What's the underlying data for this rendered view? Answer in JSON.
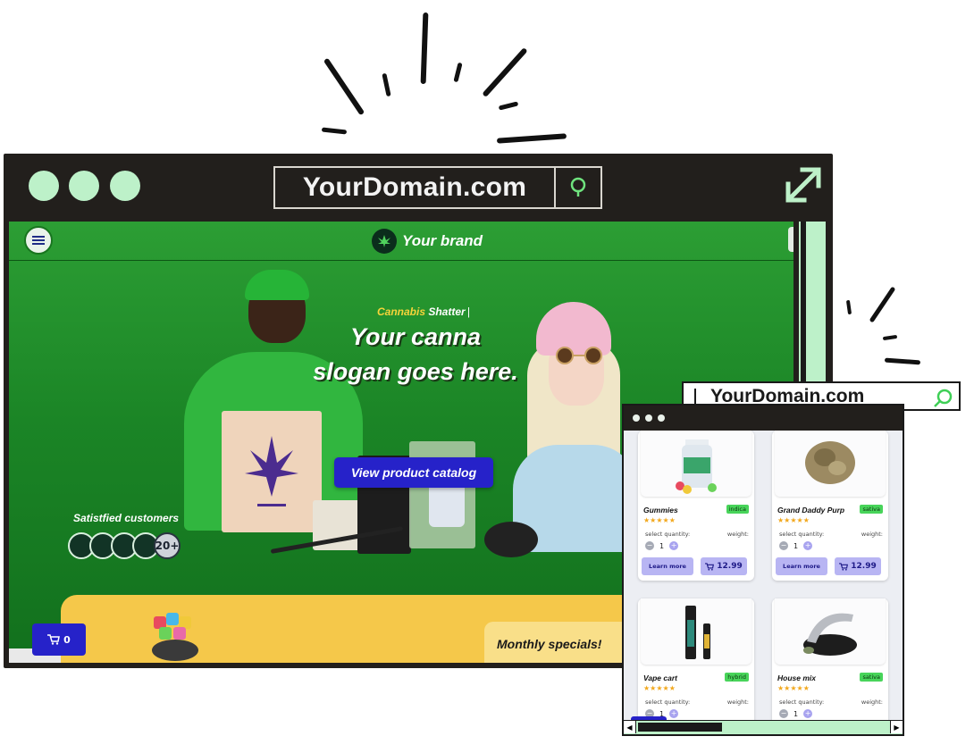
{
  "main_browser": {
    "url": "YourDomain.com",
    "icons": {
      "search": "search-icon",
      "expand": "expand-arrows-icon"
    },
    "header": {
      "brand": "Your brand",
      "menu_icon": "hamburger-menu-icon",
      "logo_icon": "cannabis-leaf-logo-icon"
    },
    "hero": {
      "tag_highlight": "Cannabis",
      "tag_rest": " Shatter",
      "tag_cursor": "|",
      "slogan_line1": "Your canna",
      "slogan_line2": "slogan goes here.",
      "cta": "View product catalog",
      "satisfied_label": "Satistfied customers",
      "customer_count": "20+"
    },
    "cart": {
      "count": "0",
      "icon": "cart-icon"
    },
    "specials_label": "Monthly specials!"
  },
  "secondary_browser": {
    "url": "YourDomain.com",
    "products": [
      {
        "name": "Gummies",
        "badge": "indica",
        "rating": 5,
        "stars": "★★★★★",
        "quantity_label": "select quantity:",
        "weight_label": "weight:",
        "quantity": "1",
        "learn_more": "Learn more",
        "price": "12.99"
      },
      {
        "name": "Grand Daddy Purp",
        "badge": "sativa",
        "rating": 5,
        "stars": "★★★★★",
        "quantity_label": "select quantity:",
        "weight_label": "weight:",
        "quantity": "1",
        "learn_more": "Learn more",
        "price": "12.99"
      },
      {
        "name": "Vape cart",
        "badge": "hybrid",
        "rating": 5,
        "stars": "★★★★★",
        "quantity_label": "select quantity:",
        "weight_label": "weight:",
        "quantity": "1"
      },
      {
        "name": "House mix",
        "badge": "sativa",
        "rating": 5,
        "stars": "★★★★★",
        "quantity_label": "select quantity:",
        "weight_label": "weight:",
        "quantity": "1"
      }
    ]
  },
  "colors": {
    "chrome": "#221f1c",
    "mint": "#bdf1c9",
    "hero_green": "#1b8526",
    "cta_blue": "#2622c9",
    "accent_yellow": "#f5c84a",
    "badge_green": "#48d45a",
    "star": "#f2a81d"
  }
}
